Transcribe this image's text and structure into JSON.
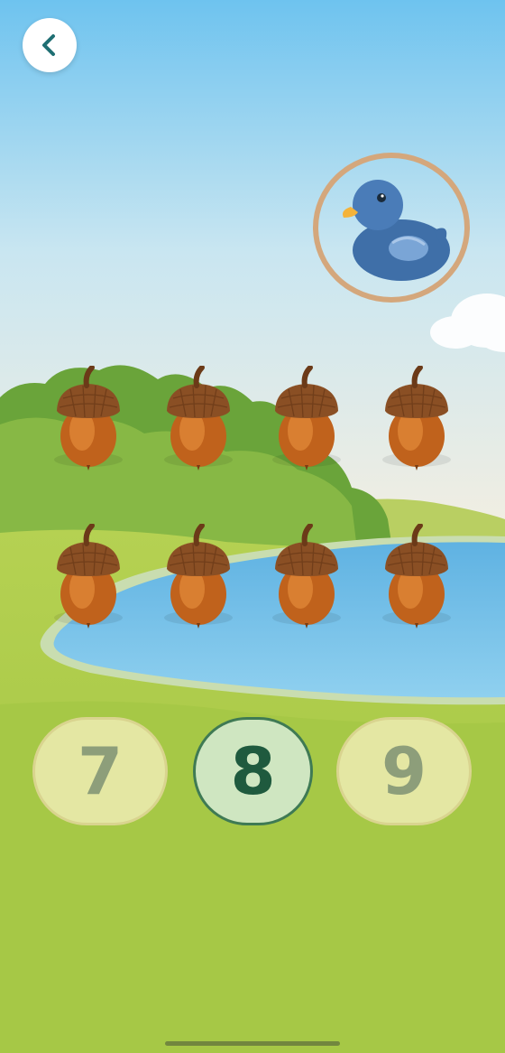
{
  "screen": {
    "name": "counting-game"
  },
  "back_button": {
    "icon": "chevron-left-icon",
    "color": "#1f6f73"
  },
  "target_item": {
    "icon": "duck-icon",
    "ring_color": "#d4a77c"
  },
  "items": {
    "icon": "acorn-icon",
    "count": 8,
    "rows": [
      {
        "cells": [
          "acorn",
          "acorn",
          "acorn",
          "acorn"
        ]
      },
      {
        "cells": [
          "acorn",
          "acorn",
          "acorn",
          "acorn"
        ]
      }
    ]
  },
  "answers": [
    {
      "label": "7",
      "state": "dim"
    },
    {
      "label": "8",
      "state": "selected"
    },
    {
      "label": "9",
      "state": "dim"
    }
  ],
  "colors": {
    "sky_top": "#6ec3ef",
    "sky_bottom": "#f4efe0",
    "grass": "#a5c74a",
    "lake": "#7ec6ea",
    "selected_text": "#1f5a3e",
    "dim_text": "#8d9e7a"
  }
}
